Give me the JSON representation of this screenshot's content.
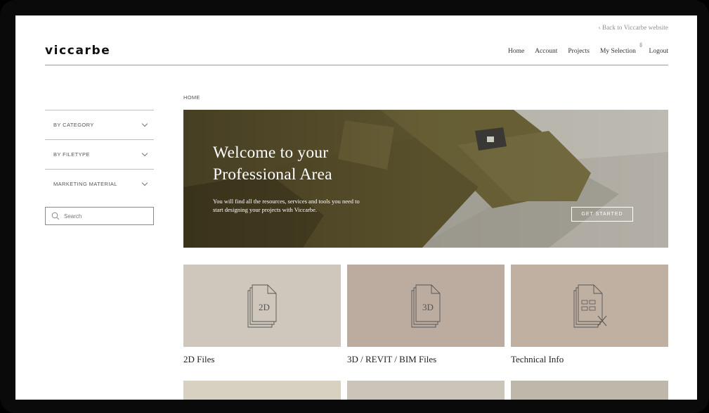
{
  "top": {
    "back_link": "‹ Back to Viccarbe website"
  },
  "brand": {
    "logo": "viccarbe"
  },
  "nav": {
    "items": [
      "Home",
      "Account",
      "Projects",
      "My Selection",
      "Logout"
    ],
    "selection_count": "0"
  },
  "sidebar": {
    "filters": [
      "BY CATEGORY",
      "BY FILETYPE",
      "MARKETING MATERIAL"
    ],
    "search_placeholder": "Search"
  },
  "breadcrumb": "HOME",
  "hero": {
    "title_line1": "Welcome to your",
    "title_line2": "Professional Area",
    "text": "You will find all the resources, services and tools you need to start designing your projects with Viccarbe.",
    "button": "GET STARTED"
  },
  "cards": [
    {
      "label": "2D Files",
      "icon_text": "2D",
      "color": "#cfc7bb"
    },
    {
      "label": "3D / REVIT / BIM Files",
      "icon_text": "3D",
      "color": "#bcaca0"
    },
    {
      "label": "Technical Info",
      "icon_text": "",
      "color": "#c0b0a2"
    }
  ],
  "bottom_tiles": [
    "#d8d1c1",
    "#cbc4b9",
    "#bdb8a9"
  ]
}
